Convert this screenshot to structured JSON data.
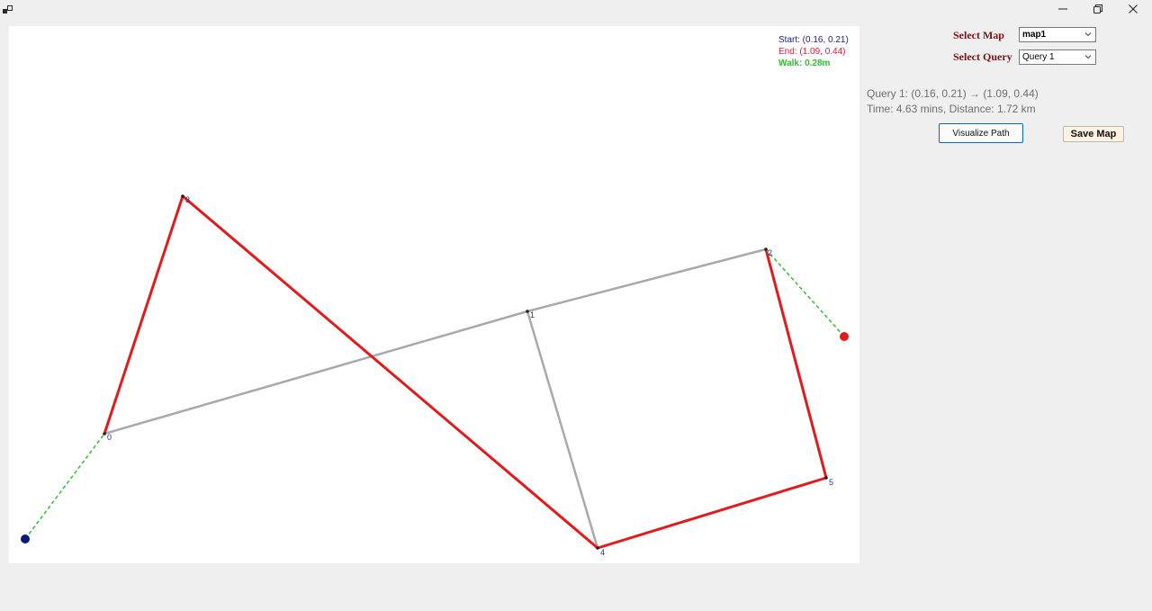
{
  "window": {
    "icons": {
      "app": "app-icon",
      "minimize": "minimize-icon",
      "maximize": "restore-icon",
      "close": "close-icon"
    }
  },
  "legend": {
    "start": "Start: (0.16, 0.21)",
    "end": "End: (1.09, 0.44)",
    "walk": "Walk: 0.28m"
  },
  "controls": {
    "select_map_label": "Select Map",
    "select_map_value": "map1",
    "select_query_label": "Select Query",
    "select_query_value": "Query 1",
    "visualize_label": "Visualize Path",
    "save_label": "Save Map"
  },
  "info": {
    "query_line": "Query 1: (0.16, 0.21) → (1.09, 0.44)",
    "summary_line": "Time: 4.63 mins, Distance: 1.72 km"
  },
  "map": {
    "colors": {
      "path": "#e41a1a",
      "edge": "#a9a9a9",
      "walk": "#2fbf2f",
      "start": "#0a1a78",
      "end": "#e41a1a",
      "node": "#222222",
      "label": "#2a2aa8"
    },
    "node_labels": [
      "0",
      "1",
      "2",
      "3",
      "4",
      "5"
    ]
  }
}
